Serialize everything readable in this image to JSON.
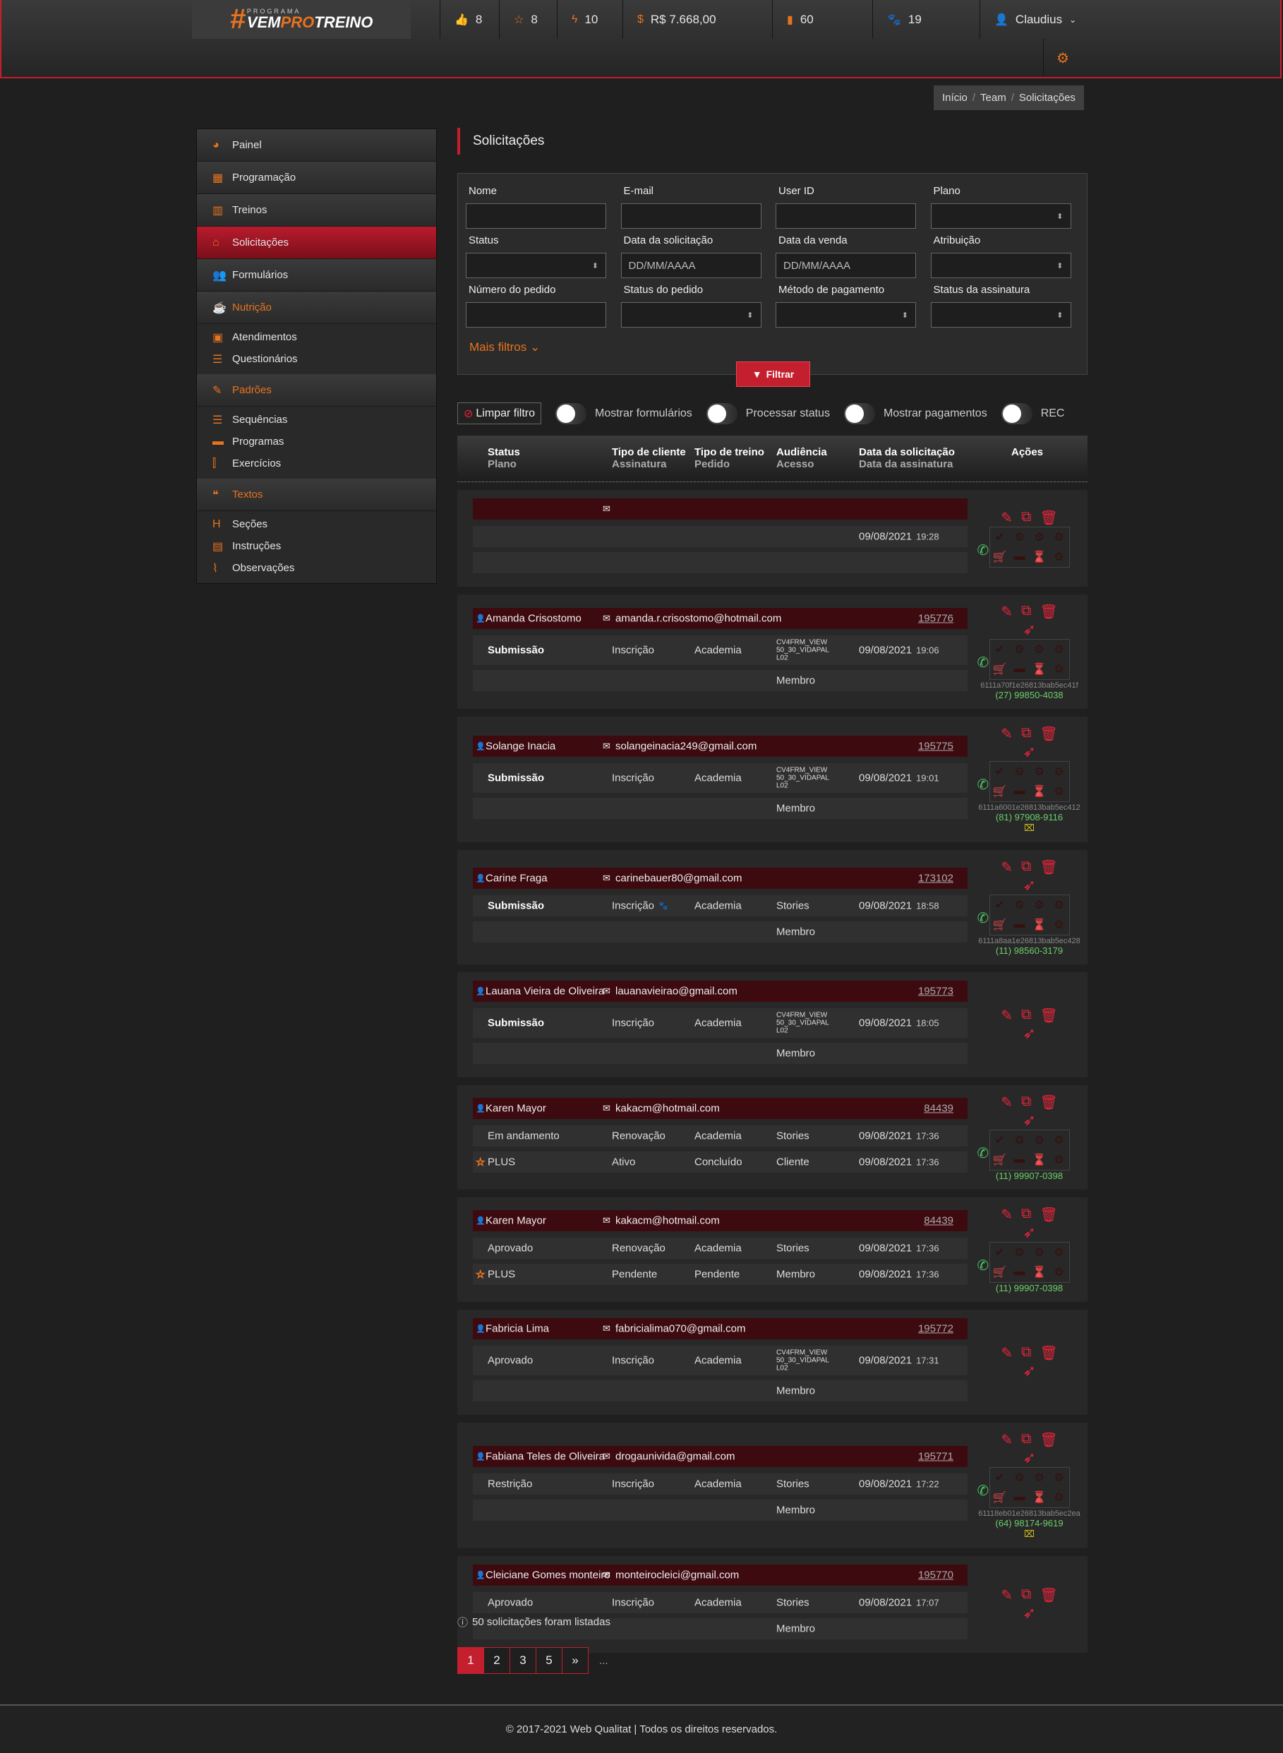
{
  "header": {
    "logo_text": "#VEMPROTREINO",
    "logo_top": "PROGRAMA",
    "stats": [
      {
        "icon": "thumbs-up-icon",
        "value": "8"
      },
      {
        "icon": "star-icon",
        "value": "8"
      },
      {
        "icon": "bolt-icon",
        "value": "10"
      },
      {
        "icon": "money-icon",
        "value": "R$ 7.668,00"
      },
      {
        "icon": "file-icon",
        "value": "60"
      },
      {
        "icon": "paw-icon",
        "value": "19"
      }
    ],
    "user": "Claudius"
  },
  "breadcrumb": [
    "Início",
    "Team",
    "Solicitações"
  ],
  "sidebar": {
    "items": [
      {
        "label": "Painel",
        "icon": "◕"
      },
      {
        "label": "Programação",
        "icon": "▦"
      },
      {
        "label": "Treinos",
        "icon": "▥"
      },
      {
        "label": "Solicitações",
        "icon": "⌂"
      },
      {
        "label": "Formulários",
        "icon": "👥"
      }
    ],
    "groups": [
      {
        "label": "Nutrição",
        "icon": "☕",
        "items": [
          {
            "label": "Atendimentos",
            "icon": "▣"
          },
          {
            "label": "Questionários",
            "icon": "☰"
          }
        ]
      },
      {
        "label": "Padrões",
        "icon": "✎",
        "items": [
          {
            "label": "Sequências",
            "icon": "☰"
          },
          {
            "label": "Programas",
            "icon": "▬"
          },
          {
            "label": "Exercícios",
            "icon": "⫿"
          }
        ]
      },
      {
        "label": "Textos",
        "icon": "❝",
        "items": [
          {
            "label": "Seções",
            "icon": "H"
          },
          {
            "label": "Instruções",
            "icon": "▤"
          },
          {
            "label": "Observações",
            "icon": "⌇"
          }
        ]
      }
    ]
  },
  "page_title": "Solicitações",
  "filters": {
    "fields": [
      {
        "label": "Nome",
        "value": "",
        "select": false
      },
      {
        "label": "E-mail",
        "value": "",
        "select": false
      },
      {
        "label": "User ID",
        "value": "",
        "select": false
      },
      {
        "label": "Plano",
        "value": "",
        "select": true
      },
      {
        "label": "Status",
        "value": "",
        "select": true
      },
      {
        "label": "Data da solicitação",
        "value": "DD/MM/AAAA",
        "select": false
      },
      {
        "label": "Data da venda",
        "value": "DD/MM/AAAA",
        "select": false
      },
      {
        "label": "Atribuição",
        "value": "",
        "select": true
      },
      {
        "label": "Número do pedido",
        "value": "",
        "select": false
      },
      {
        "label": "Status do pedido",
        "value": "",
        "select": true
      },
      {
        "label": "Método de pagamento",
        "value": "",
        "select": true
      },
      {
        "label": "Status da assinatura",
        "value": "",
        "select": true
      }
    ],
    "more": "Mais filtros",
    "submit": "Filtrar"
  },
  "toolbar": {
    "clear": "Limpar filtro",
    "toggles": [
      "Mostrar formulários",
      "Processar status",
      "Mostrar pagamentos",
      "REC"
    ]
  },
  "table_header": [
    {
      "top": "Status",
      "bottom": "Plano"
    },
    {
      "top": "Tipo de cliente",
      "bottom": "Assinatura"
    },
    {
      "top": "Tipo de treino",
      "bottom": "Pedido"
    },
    {
      "top": "Audiência",
      "bottom": "Acesso"
    },
    {
      "top": "Data da solicitação",
      "bottom": "Data da assinatura"
    },
    {
      "top": "Ações",
      "bottom": ""
    }
  ],
  "requests": [
    {
      "name": "",
      "email": "",
      "order": "",
      "r1": [
        "",
        "",
        "",
        "",
        "09/08/2021",
        "19:28"
      ],
      "r2": [
        "",
        "",
        "",
        "",
        "",
        ""
      ],
      "rocket": false,
      "grid": true,
      "hash": "",
      "phone": "",
      "warn": false
    },
    {
      "name": "Amanda Crisostomo",
      "email": "amanda.r.crisostomo@hotmail.com",
      "order": "195776",
      "r1": [
        "Submissão",
        "Inscrição",
        "Academia",
        "CV4FRM_VIEW 50_30_VIDAPAL L02",
        "09/08/2021",
        "19:06"
      ],
      "r2": [
        "",
        "",
        "",
        "Membro",
        "",
        ""
      ],
      "rocket": true,
      "grid": true,
      "hash": "6111a70f1e26813bab5ec41f",
      "phone": "(27) 99850-4038",
      "warn": false
    },
    {
      "name": "Solange Inacia",
      "email": "solangeinacia249@gmail.com",
      "order": "195775",
      "r1": [
        "Submissão",
        "Inscrição",
        "Academia",
        "CV4FRM_VIEW 50_30_VIDAPAL L02",
        "09/08/2021",
        "19:01"
      ],
      "r2": [
        "",
        "",
        "",
        "Membro",
        "",
        ""
      ],
      "rocket": true,
      "grid": true,
      "hash": "6111a6001e26813bab5ec412",
      "phone": "(81) 97908-9116",
      "warn": true
    },
    {
      "name": "Carine Fraga",
      "email": "carinebauer80@gmail.com",
      "order": "173102",
      "r1": [
        "Submissão",
        "Inscrição",
        "Academia",
        "Stories",
        "09/08/2021",
        "18:58"
      ],
      "r2": [
        "",
        "",
        "",
        "Membro",
        "",
        ""
      ],
      "paw": true,
      "rocket": true,
      "grid": true,
      "hash": "6111a8aa1e26813bab5ec428",
      "phone": "(11) 98560-3179",
      "warn": false
    },
    {
      "name": "Lauana Vieira de Oliveira",
      "email": "lauanavieirao@gmail.com",
      "order": "195773",
      "r1": [
        "Submissão",
        "Inscrição",
        "Academia",
        "CV4FRM_VIEW 50_30_VIDAPAL L02",
        "09/08/2021",
        "18:05"
      ],
      "r2": [
        "",
        "",
        "",
        "Membro",
        "",
        ""
      ],
      "rocket": true,
      "grid": false,
      "hash": "",
      "phone": "",
      "warn": false
    },
    {
      "name": "Karen Mayor",
      "email": "kakacm@hotmail.com",
      "order": "84439",
      "r1": [
        "Em andamento",
        "Renovação",
        "Academia",
        "Stories",
        "09/08/2021",
        "17:36"
      ],
      "r2": [
        "PLUS",
        "Ativo",
        "Concluído",
        "Cliente",
        "09/08/2021",
        "17:36"
      ],
      "star": "#e8731e",
      "rocket": true,
      "grid": true,
      "hash": "",
      "phone": "(11) 99907-0398",
      "warn": false
    },
    {
      "name": "Karen Mayor",
      "email": "kakacm@hotmail.com",
      "order": "84439",
      "r1": [
        "Aprovado",
        "Renovação",
        "Academia",
        "Stories",
        "09/08/2021",
        "17:36"
      ],
      "r2": [
        "PLUS",
        "Pendente",
        "Pendente",
        "Membro",
        "09/08/2021",
        "17:36"
      ],
      "star": "#111111",
      "rocket": true,
      "grid": true,
      "hash": "",
      "phone": "(11) 99907-0398",
      "warn": false
    },
    {
      "name": "Fabricia Lima",
      "email": "fabricialima070@gmail.com",
      "order": "195772",
      "r1": [
        "Aprovado",
        "Inscrição",
        "Academia",
        "CV4FRM_VIEW 50_30_VIDAPAL L02",
        "09/08/2021",
        "17:31"
      ],
      "r2": [
        "",
        "",
        "",
        "Membro",
        "",
        ""
      ],
      "rocket": true,
      "grid": false,
      "hash": "",
      "phone": "",
      "warn": false
    },
    {
      "name": "Fabiana Teles de Oliveira",
      "email": "drogaunivida@gmail.com",
      "order": "195771",
      "r1": [
        "Restrição",
        "Inscrição",
        "Academia",
        "Stories",
        "09/08/2021",
        "17:22"
      ],
      "r2": [
        "",
        "",
        "",
        "Membro",
        "",
        ""
      ],
      "rocket": true,
      "grid": true,
      "hash": "61118eb01e26813bab5ec2ea",
      "phone": "(64) 98174-9619",
      "warn": true
    },
    {
      "name": "Cleiciane Gomes monteiro",
      "email": "monteirocleici@gmail.com",
      "order": "195770",
      "r1": [
        "Aprovado",
        "Inscrição",
        "Academia",
        "Stories",
        "09/08/2021",
        "17:07"
      ],
      "r2": [
        "",
        "",
        "",
        "Membro",
        "",
        ""
      ],
      "rocket": true,
      "grid": false,
      "hash": "",
      "phone": "",
      "warn": false
    }
  ],
  "summary": "50 solicitações foram listadas",
  "pagination": [
    "1",
    "2",
    "3",
    "5",
    "»"
  ],
  "pagination_more": "...",
  "footer": "© 2017-2021 Web Qualitat | Todos os direitos reservados.",
  "colors": {
    "accent": "#c41f2e",
    "orange": "#e8731e",
    "whatsapp": "#4cc764"
  }
}
